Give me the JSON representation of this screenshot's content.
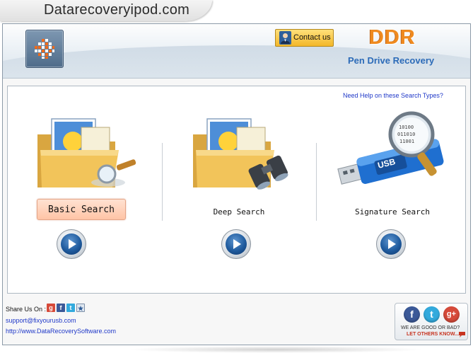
{
  "banner": {
    "site": "Datarecoveryipod.com"
  },
  "header": {
    "contact_label": "Contact us",
    "brand": "DDR",
    "product": "Pen Drive Recovery"
  },
  "main": {
    "help_link": "Need Help on these Search Types?",
    "options": [
      {
        "label": "Basic Search",
        "icon": "folder-magnifier-icon",
        "selected": true
      },
      {
        "label": "Deep Search",
        "icon": "folder-binoculars-icon",
        "selected": false
      },
      {
        "label": "Signature Search",
        "icon": "usb-drive-magnifier-icon",
        "selected": false
      }
    ]
  },
  "footer": {
    "share_label": "Share Us On :",
    "share_icons": [
      "google-plus-icon",
      "facebook-icon",
      "twitter-icon",
      "bookmark-icon"
    ],
    "email": "support@fixyourusb.com",
    "website": "http://www.DataRecoverySoftware.com",
    "feedback_question": "WE ARE GOOD OR BAD?",
    "feedback_cta": "LET OTHERS KNOW..."
  },
  "colors": {
    "brand_orange": "#ef8a1f",
    "product_blue": "#2c6bb8",
    "link_blue": "#1f38c8",
    "selected_bg": "#ffd3bd",
    "facebook": "#3b5998",
    "twitter": "#33aadd",
    "google": "#d64a3a"
  }
}
